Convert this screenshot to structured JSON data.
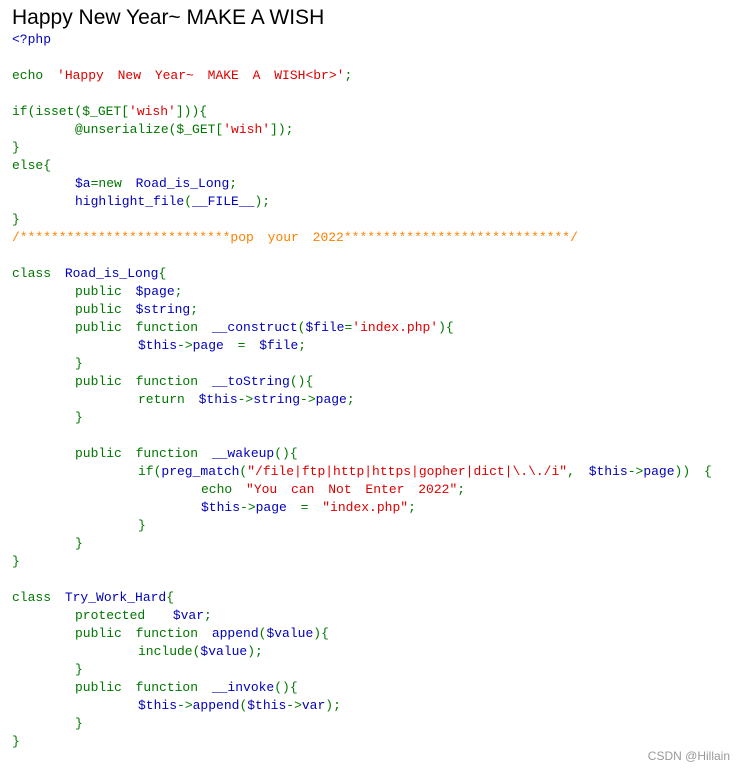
{
  "title": "Happy New Year~ MAKE A WISH",
  "watermark": "CSDN @Hillain",
  "colors": {
    "keyword": "#007700",
    "default": "#0000BB",
    "string": "#DD0000",
    "comment": "#FF8000"
  },
  "code_lines": [
    {
      "i": 0,
      "t": [
        [
          "d",
          "<?php"
        ]
      ]
    },
    {
      "i": 0,
      "t": []
    },
    {
      "i": 0,
      "t": [
        [
          "k",
          "echo "
        ],
        [
          "s",
          "'Happy New Year~ MAKE A WISH<br>'"
        ],
        [
          "k",
          ";"
        ]
      ]
    },
    {
      "i": 0,
      "t": []
    },
    {
      "i": 0,
      "t": [
        [
          "k",
          "if(isset($_GET["
        ],
        [
          "s",
          "'wish'"
        ],
        [
          "k",
          "])){"
        ]
      ]
    },
    {
      "i": 1,
      "t": [
        [
          "k",
          "@unserialize($_GET["
        ],
        [
          "s",
          "'wish'"
        ],
        [
          "k",
          "]);"
        ]
      ]
    },
    {
      "i": 0,
      "t": [
        [
          "k",
          "}"
        ]
      ]
    },
    {
      "i": 0,
      "t": [
        [
          "k",
          "else{"
        ]
      ]
    },
    {
      "i": 1,
      "t": [
        [
          "d",
          "$a"
        ],
        [
          "k",
          "=new "
        ],
        [
          "d",
          "Road_is_Long"
        ],
        [
          "k",
          ";"
        ]
      ]
    },
    {
      "i": 1,
      "t": [
        [
          "d",
          "highlight_file"
        ],
        [
          "k",
          "("
        ],
        [
          "d",
          "__FILE__"
        ],
        [
          "k",
          ");"
        ]
      ]
    },
    {
      "i": 0,
      "t": [
        [
          "k",
          "}"
        ]
      ]
    },
    {
      "i": 0,
      "t": [
        [
          "c",
          "/***************************pop your 2022*****************************/"
        ]
      ]
    },
    {
      "i": 0,
      "t": []
    },
    {
      "i": 0,
      "t": [
        [
          "k",
          "class "
        ],
        [
          "d",
          "Road_is_Long"
        ],
        [
          "k",
          "{"
        ]
      ]
    },
    {
      "i": 1,
      "t": [
        [
          "k",
          "public "
        ],
        [
          "d",
          "$page"
        ],
        [
          "k",
          ";"
        ]
      ]
    },
    {
      "i": 1,
      "t": [
        [
          "k",
          "public "
        ],
        [
          "d",
          "$string"
        ],
        [
          "k",
          ";"
        ]
      ]
    },
    {
      "i": 1,
      "t": [
        [
          "k",
          "public function "
        ],
        [
          "d",
          "__construct"
        ],
        [
          "k",
          "("
        ],
        [
          "d",
          "$file"
        ],
        [
          "k",
          "="
        ],
        [
          "s",
          "'index.php'"
        ],
        [
          "k",
          "){"
        ]
      ]
    },
    {
      "i": 2,
      "t": [
        [
          "d",
          "$this"
        ],
        [
          "k",
          "->"
        ],
        [
          "d",
          "page "
        ],
        [
          "k",
          "= "
        ],
        [
          "d",
          "$file"
        ],
        [
          "k",
          ";"
        ]
      ]
    },
    {
      "i": 1,
      "t": [
        [
          "k",
          "}"
        ]
      ]
    },
    {
      "i": 1,
      "t": [
        [
          "k",
          "public function "
        ],
        [
          "d",
          "__toString"
        ],
        [
          "k",
          "(){"
        ]
      ]
    },
    {
      "i": 2,
      "t": [
        [
          "k",
          "return "
        ],
        [
          "d",
          "$this"
        ],
        [
          "k",
          "->"
        ],
        [
          "d",
          "string"
        ],
        [
          "k",
          "->"
        ],
        [
          "d",
          "page"
        ],
        [
          "k",
          ";"
        ]
      ]
    },
    {
      "i": 1,
      "t": [
        [
          "k",
          "}"
        ]
      ]
    },
    {
      "i": 0,
      "t": []
    },
    {
      "i": 1,
      "t": [
        [
          "k",
          "public function "
        ],
        [
          "d",
          "__wakeup"
        ],
        [
          "k",
          "(){"
        ]
      ]
    },
    {
      "i": 2,
      "t": [
        [
          "k",
          "if("
        ],
        [
          "d",
          "preg_match"
        ],
        [
          "k",
          "("
        ],
        [
          "s",
          "\"/file|ftp|http|https|gopher|dict|\\.\\./i\""
        ],
        [
          "k",
          ", "
        ],
        [
          "d",
          "$this"
        ],
        [
          "k",
          "->"
        ],
        [
          "d",
          "page"
        ],
        [
          "k",
          ")) {"
        ]
      ]
    },
    {
      "i": 3,
      "t": [
        [
          "k",
          "echo "
        ],
        [
          "s",
          "\"You can Not Enter 2022\""
        ],
        [
          "k",
          ";"
        ]
      ]
    },
    {
      "i": 3,
      "t": [
        [
          "d",
          "$this"
        ],
        [
          "k",
          "->"
        ],
        [
          "d",
          "page "
        ],
        [
          "k",
          "= "
        ],
        [
          "s",
          "\"index.php\""
        ],
        [
          "k",
          ";"
        ]
      ]
    },
    {
      "i": 2,
      "t": [
        [
          "k",
          "}"
        ]
      ]
    },
    {
      "i": 1,
      "t": [
        [
          "k",
          "}"
        ]
      ]
    },
    {
      "i": 0,
      "t": [
        [
          "k",
          "}"
        ]
      ]
    },
    {
      "i": 0,
      "t": []
    },
    {
      "i": 0,
      "t": [
        [
          "k",
          "class "
        ],
        [
          "d",
          "Try_Work_Hard"
        ],
        [
          "k",
          "{"
        ]
      ]
    },
    {
      "i": 1,
      "t": [
        [
          "k",
          "protected  "
        ],
        [
          "d",
          "$var"
        ],
        [
          "k",
          ";"
        ]
      ]
    },
    {
      "i": 1,
      "t": [
        [
          "k",
          "public function "
        ],
        [
          "d",
          "append"
        ],
        [
          "k",
          "("
        ],
        [
          "d",
          "$value"
        ],
        [
          "k",
          "){"
        ]
      ]
    },
    {
      "i": 2,
      "t": [
        [
          "k",
          "include("
        ],
        [
          "d",
          "$value"
        ],
        [
          "k",
          ");"
        ]
      ]
    },
    {
      "i": 1,
      "t": [
        [
          "k",
          "}"
        ]
      ]
    },
    {
      "i": 1,
      "t": [
        [
          "k",
          "public function "
        ],
        [
          "d",
          "__invoke"
        ],
        [
          "k",
          "(){"
        ]
      ]
    },
    {
      "i": 2,
      "t": [
        [
          "d",
          "$this"
        ],
        [
          "k",
          "->"
        ],
        [
          "d",
          "append"
        ],
        [
          "k",
          "("
        ],
        [
          "d",
          "$this"
        ],
        [
          "k",
          "->"
        ],
        [
          "d",
          "var"
        ],
        [
          "k",
          ");"
        ]
      ]
    },
    {
      "i": 1,
      "t": [
        [
          "k",
          "}"
        ]
      ]
    },
    {
      "i": 0,
      "t": [
        [
          "k",
          "}"
        ]
      ]
    }
  ]
}
